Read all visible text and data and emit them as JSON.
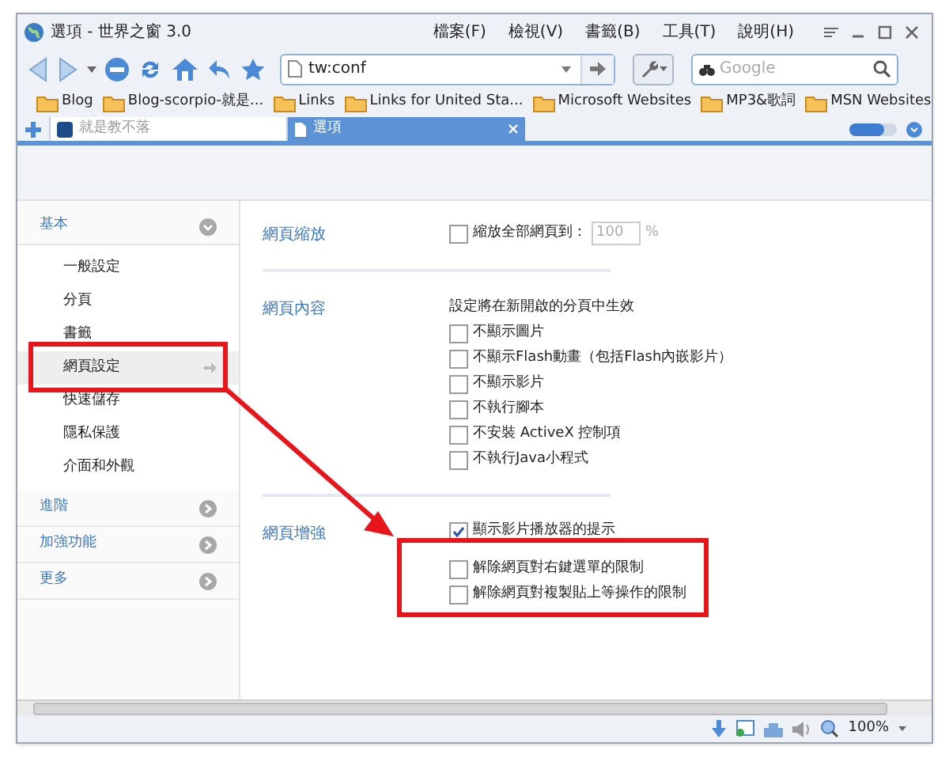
{
  "window": {
    "title": "選項 - 世界之窗 3.0"
  },
  "menu": [
    "檔案(F)",
    "檢視(V)",
    "書籤(B)",
    "工具(T)",
    "說明(H)"
  ],
  "address": {
    "value": "tw:conf"
  },
  "search": {
    "placeholder": "Google"
  },
  "bookmarks": [
    {
      "label": "Blog",
      "kind": "folder"
    },
    {
      "label": "Blog-scorpio-就是...",
      "kind": "folder"
    },
    {
      "label": "Links",
      "kind": "folder"
    },
    {
      "label": "Links for United Sta...",
      "kind": "folder"
    },
    {
      "label": "Microsoft Websites",
      "kind": "folder"
    },
    {
      "label": "MP3&歌詞",
      "kind": "folder"
    },
    {
      "label": "MSN Websites",
      "kind": "folder"
    }
  ],
  "tabs": [
    {
      "label": "就是教不落",
      "selected": false
    },
    {
      "label": "選項",
      "selected": true
    }
  ],
  "sidebar": [
    {
      "label": "基本",
      "expanded": true,
      "children": [
        {
          "label": "一般設定",
          "selected": false
        },
        {
          "label": "分頁",
          "selected": false
        },
        {
          "label": "書籤",
          "selected": false
        },
        {
          "label": "網頁設定",
          "selected": true
        },
        {
          "label": "快速儲存",
          "selected": false
        },
        {
          "label": "隱私保護",
          "selected": false
        },
        {
          "label": "介面和外觀",
          "selected": false
        }
      ]
    },
    {
      "label": "進階",
      "expanded": false
    },
    {
      "label": "加強功能",
      "expanded": false
    },
    {
      "label": "更多",
      "expanded": false
    }
  ],
  "sections": [
    {
      "title": "網頁縮放",
      "options": [
        {
          "label": "縮放全部網頁到：",
          "checked": false,
          "value": "100",
          "unit": "%"
        }
      ]
    },
    {
      "title": "網頁內容",
      "note": "設定將在新開啟的分頁中生效",
      "options": [
        {
          "label": "不顯示圖片",
          "checked": false
        },
        {
          "label": "不顯示Flash動畫（包括Flash內嵌影片）",
          "checked": false
        },
        {
          "label": "不顯示影片",
          "checked": false
        },
        {
          "label": "不執行腳本",
          "checked": false
        },
        {
          "label": "不安裝 ActiveX 控制項",
          "checked": false
        },
        {
          "label": "不執行Java小程式",
          "checked": false
        }
      ]
    },
    {
      "title": "網頁增強",
      "options": [
        {
          "label": "顯示影片播放器的提示",
          "checked": true
        },
        {
          "label": "解除網頁對右鍵選單的限制",
          "checked": false
        },
        {
          "label": "解除網頁對複製貼上等操作的限制",
          "checked": false
        }
      ]
    }
  ],
  "status_bar": {
    "zoom": "100%"
  }
}
